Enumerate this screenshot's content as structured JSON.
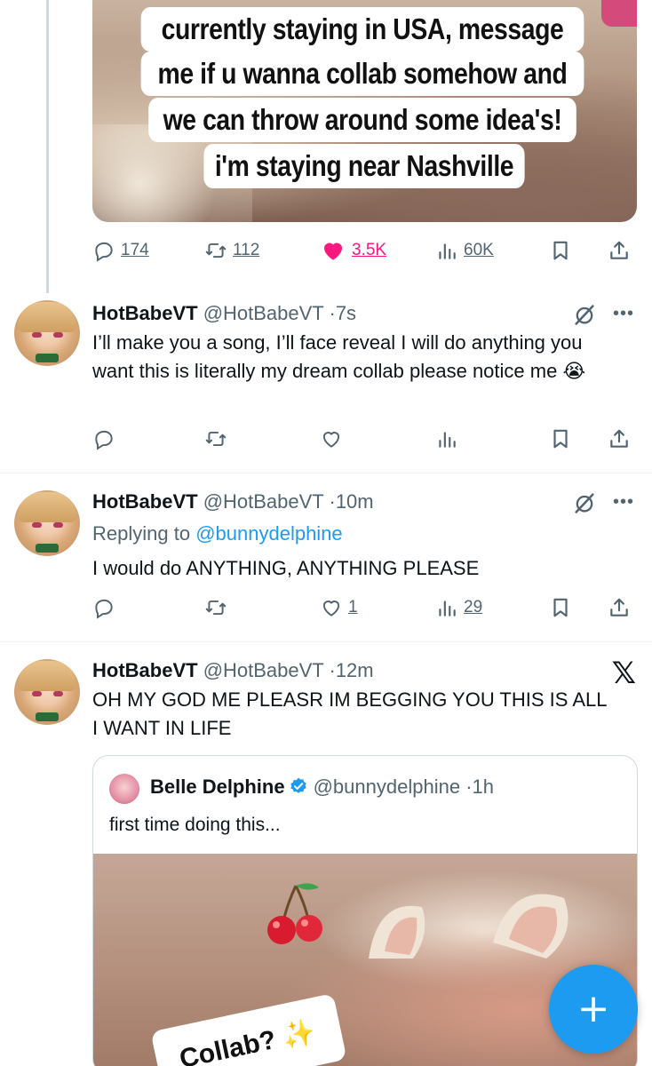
{
  "top_tweet": {
    "caption_lines": [
      "currently staying in USA, message",
      "me if u wanna collab somehow and",
      "we can throw around some idea's!",
      "i'm staying near Nashville"
    ],
    "replies": "174",
    "retweets": "112",
    "likes": "3.5K",
    "views": "60K",
    "liked": true
  },
  "tweets": [
    {
      "name": "HotBabeVT",
      "handle": "@HotBabeVT",
      "time": "7s",
      "text": "I’ll make you a song, I’ll face reveal I will do anything you want this is literally my dream collab please notice me 😭",
      "replies": "",
      "retweets": "",
      "likes": "",
      "views": ""
    },
    {
      "name": "HotBabeVT",
      "handle": "@HotBabeVT",
      "time": "10m",
      "replying_label": "Replying to",
      "replying_handle": "@bunnydelphine",
      "text": "I would do ANYTHING, ANYTHING PLEASE",
      "replies": "",
      "retweets": "",
      "likes": "1",
      "views": "29"
    },
    {
      "name": "HotBabeVT",
      "handle": "@HotBabeVT",
      "time": "12m",
      "text": "OH MY GOD ME PLEASR IM BEGGING YOU THIS IS ALL I WANT IN LIFE"
    }
  ],
  "quote": {
    "name": "Belle Delphine",
    "handle": "@bunnydelphine",
    "time": "1h",
    "text": "first time doing this...",
    "media_caption": "Collab? ✨"
  },
  "icons": {
    "reply": "reply-icon",
    "retweet": "retweet-icon",
    "like": "heart-icon",
    "views": "views-icon",
    "bookmark": "bookmark-icon",
    "share": "share-icon",
    "grok": "grok-icon",
    "more": "more-icon",
    "compose": "compose-plus-icon",
    "x_logo": "x-logo-icon"
  },
  "colors": {
    "like_active": "#f91880",
    "link": "#1d9bf0",
    "secondary_text": "#536471"
  },
  "misc": {
    "dot": "·",
    "more": "•••",
    "x_logo": "𝕏",
    "compose": "+"
  }
}
